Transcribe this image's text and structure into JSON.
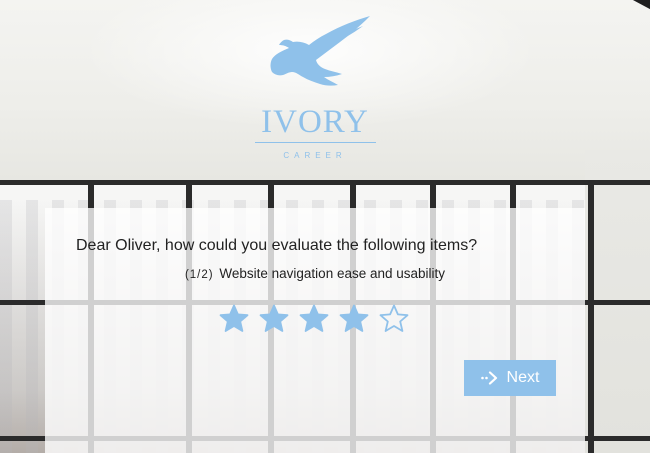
{
  "brand": {
    "name": "IVORY",
    "tagline": "CAREER",
    "logo_icon": "eagle-icon",
    "color": "#8fc1ea"
  },
  "survey": {
    "question": "Dear Oliver, how could you evaluate the following items?",
    "counter": "(1/2)",
    "item_label": "Website navigation ease and usability",
    "rating": {
      "value": 4,
      "max": 5,
      "filled_color": "#8fc1ea",
      "icon": "star-icon"
    },
    "next_label": "Next",
    "next_icon": "arrow-right-icon"
  }
}
